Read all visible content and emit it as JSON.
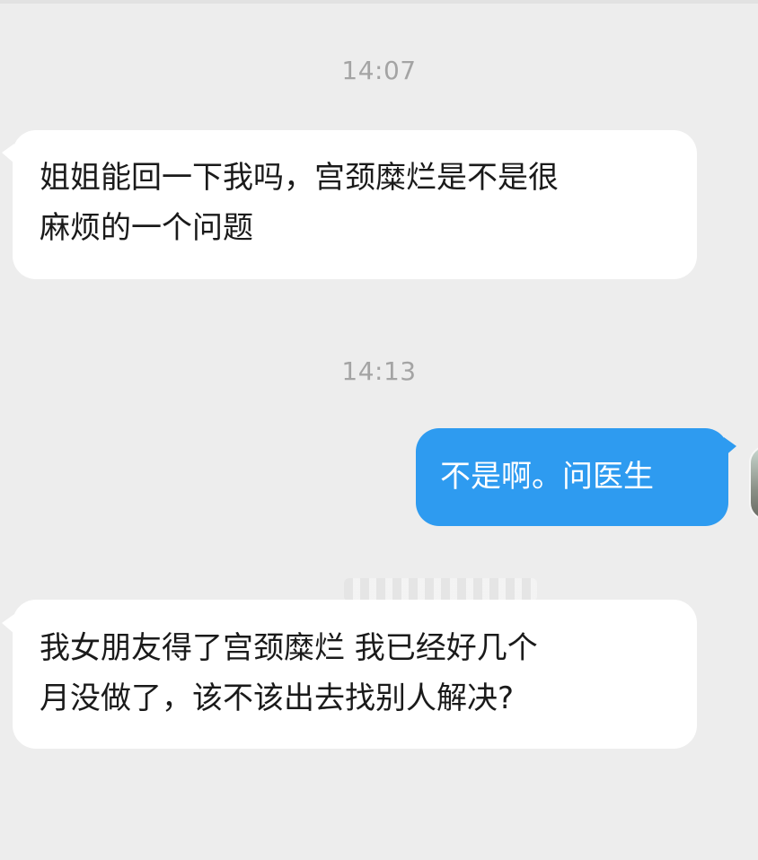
{
  "chat": {
    "messages": [
      {
        "type": "timestamp",
        "text": "14:07"
      },
      {
        "type": "incoming",
        "line1": "姐姐能回一下我吗，宫颈糜烂是不是很",
        "line2": "麻烦的一个问题"
      },
      {
        "type": "timestamp",
        "text": "14:13"
      },
      {
        "type": "outgoing",
        "text": "不是啊。问医生"
      },
      {
        "type": "incoming",
        "line1": "我女朋友得了宫颈糜烂 我已经好几个",
        "line2": "月没做了，该不该出去找别人解决?"
      }
    ]
  },
  "colors": {
    "background": "#ededed",
    "incoming_bubble": "#ffffff",
    "outgoing_bubble": "#2e9bf0",
    "timestamp_text": "#a4a4a4"
  },
  "icons": {
    "avatar": "avatar-photo",
    "watermark": "blurred-watermark"
  }
}
